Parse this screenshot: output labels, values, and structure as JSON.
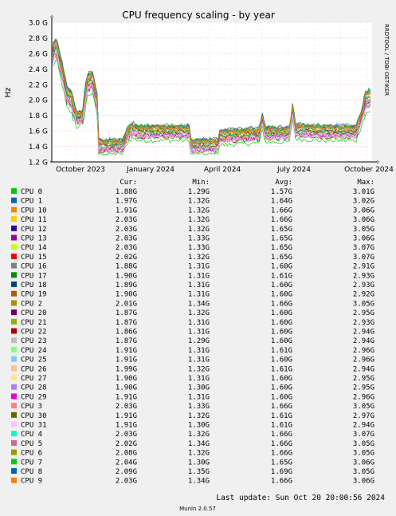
{
  "chart_data": {
    "type": "line",
    "title": "CPU frequency scaling - by year",
    "ylabel": "Hz",
    "watermark": "RRDTOOL / TOBI OETIKER",
    "ylim": [
      1.2,
      3.0
    ],
    "y_ticks": [
      "1.2 G",
      "1.4 G",
      "1.6 G",
      "1.8 G",
      "2.0 G",
      "2.2 G",
      "2.4 G",
      "2.6 G",
      "2.8 G",
      "3.0 G"
    ],
    "x_ticks": [
      "October 2023",
      "January 2024",
      "April 2024",
      "July 2024",
      "October 2024"
    ],
    "columns": {
      "cur": "Cur:",
      "min": "Min:",
      "avg": "Avg:",
      "max": "Max:"
    },
    "series": [
      {
        "name": "CPU 0",
        "color": "#00cc00",
        "cur": "1.88G",
        "min": "1.29G",
        "avg": "1.57G",
        "max": "3.01G"
      },
      {
        "name": "CPU 1",
        "color": "#0066b3",
        "cur": "1.97G",
        "min": "1.32G",
        "avg": "1.64G",
        "max": "3.02G"
      },
      {
        "name": "CPU 10",
        "color": "#ff8000",
        "cur": "1.91G",
        "min": "1.32G",
        "avg": "1.66G",
        "max": "3.06G"
      },
      {
        "name": "CPU 11",
        "color": "#ffcc00",
        "cur": "2.03G",
        "min": "1.32G",
        "avg": "1.66G",
        "max": "3.06G"
      },
      {
        "name": "CPU 12",
        "color": "#330099",
        "cur": "2.03G",
        "min": "1.32G",
        "avg": "1.65G",
        "max": "3.05G"
      },
      {
        "name": "CPU 13",
        "color": "#990099",
        "cur": "2.03G",
        "min": "1.33G",
        "avg": "1.65G",
        "max": "3.06G"
      },
      {
        "name": "CPU 14",
        "color": "#ccff00",
        "cur": "2.03G",
        "min": "1.33G",
        "avg": "1.65G",
        "max": "3.07G"
      },
      {
        "name": "CPU 15",
        "color": "#ff0000",
        "cur": "2.02G",
        "min": "1.32G",
        "avg": "1.65G",
        "max": "3.07G"
      },
      {
        "name": "CPU 16",
        "color": "#808080",
        "cur": "1.88G",
        "min": "1.31G",
        "avg": "1.60G",
        "max": "2.91G"
      },
      {
        "name": "CPU 17",
        "color": "#008f00",
        "cur": "1.90G",
        "min": "1.31G",
        "avg": "1.61G",
        "max": "2.93G"
      },
      {
        "name": "CPU 18",
        "color": "#00487d",
        "cur": "1.89G",
        "min": "1.31G",
        "avg": "1.60G",
        "max": "2.93G"
      },
      {
        "name": "CPU 19",
        "color": "#b35a00",
        "cur": "1.90G",
        "min": "1.31G",
        "avg": "1.60G",
        "max": "2.92G"
      },
      {
        "name": "CPU 2",
        "color": "#b38f00",
        "cur": "2.01G",
        "min": "1.34G",
        "avg": "1.66G",
        "max": "3.05G"
      },
      {
        "name": "CPU 20",
        "color": "#6b006b",
        "cur": "1.87G",
        "min": "1.32G",
        "avg": "1.60G",
        "max": "2.95G"
      },
      {
        "name": "CPU 21",
        "color": "#8fb300",
        "cur": "1.87G",
        "min": "1.31G",
        "avg": "1.60G",
        "max": "2.93G"
      },
      {
        "name": "CPU 22",
        "color": "#b30000",
        "cur": "1.86G",
        "min": "1.31G",
        "avg": "1.60G",
        "max": "2.94G"
      },
      {
        "name": "CPU 23",
        "color": "#bebebe",
        "cur": "1.87G",
        "min": "1.29G",
        "avg": "1.60G",
        "max": "2.94G"
      },
      {
        "name": "CPU 24",
        "color": "#80ff80",
        "cur": "1.91G",
        "min": "1.31G",
        "avg": "1.61G",
        "max": "2.96G"
      },
      {
        "name": "CPU 25",
        "color": "#80c9ff",
        "cur": "1.91G",
        "min": "1.31G",
        "avg": "1.60G",
        "max": "2.96G"
      },
      {
        "name": "CPU 26",
        "color": "#ffc080",
        "cur": "1.99G",
        "min": "1.32G",
        "avg": "1.61G",
        "max": "2.94G"
      },
      {
        "name": "CPU 27",
        "color": "#ffe680",
        "cur": "1.90G",
        "min": "1.31G",
        "avg": "1.60G",
        "max": "2.95G"
      },
      {
        "name": "CPU 28",
        "color": "#aa80ff",
        "cur": "1.90G",
        "min": "1.30G",
        "avg": "1.60G",
        "max": "2.95G"
      },
      {
        "name": "CPU 29",
        "color": "#ee00cc",
        "cur": "1.91G",
        "min": "1.31G",
        "avg": "1.60G",
        "max": "2.96G"
      },
      {
        "name": "CPU 3",
        "color": "#ff8080",
        "cur": "2.03G",
        "min": "1.33G",
        "avg": "1.66G",
        "max": "3.05G"
      },
      {
        "name": "CPU 30",
        "color": "#666600",
        "cur": "1.91G",
        "min": "1.32G",
        "avg": "1.61G",
        "max": "2.97G"
      },
      {
        "name": "CPU 31",
        "color": "#ffbfff",
        "cur": "1.91G",
        "min": "1.30G",
        "avg": "1.61G",
        "max": "2.94G"
      },
      {
        "name": "CPU 4",
        "color": "#00ffcc",
        "cur": "2.03G",
        "min": "1.32G",
        "avg": "1.66G",
        "max": "3.07G"
      },
      {
        "name": "CPU 5",
        "color": "#cc6699",
        "cur": "2.02G",
        "min": "1.34G",
        "avg": "1.66G",
        "max": "3.05G"
      },
      {
        "name": "CPU 6",
        "color": "#999900",
        "cur": "2.08G",
        "min": "1.32G",
        "avg": "1.66G",
        "max": "3.05G"
      },
      {
        "name": "CPU 7",
        "color": "#00cc00",
        "cur": "2.04G",
        "min": "1.30G",
        "avg": "1.65G",
        "max": "3.06G"
      },
      {
        "name": "CPU 8",
        "color": "#0066b3",
        "cur": "2.09G",
        "min": "1.35G",
        "avg": "1.69G",
        "max": "3.05G"
      },
      {
        "name": "CPU 9",
        "color": "#ff8000",
        "cur": "2.03G",
        "min": "1.34G",
        "avg": "1.66G",
        "max": "3.06G"
      }
    ]
  },
  "footer": {
    "last_update": "Last update: Sun Oct 20 20:00:56 2024",
    "generator": "Munin 2.0.57"
  }
}
